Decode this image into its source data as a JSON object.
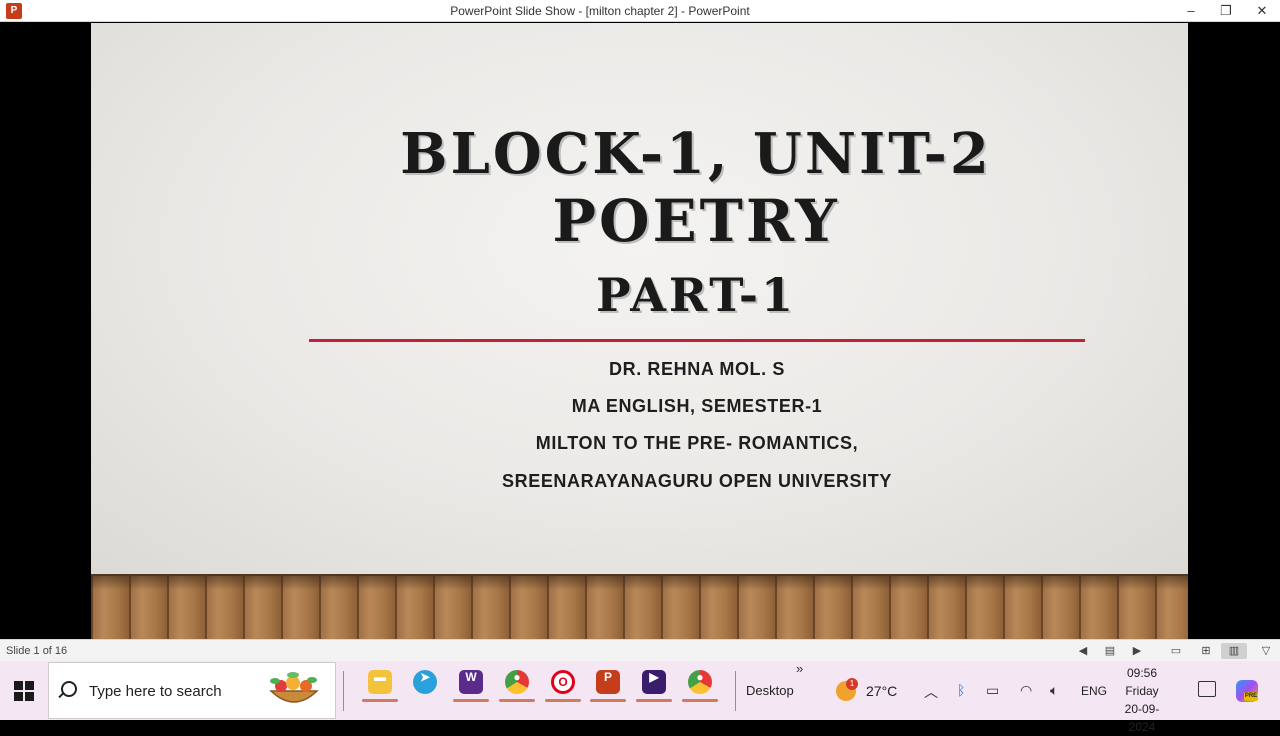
{
  "window": {
    "title": "PowerPoint Slide Show - [milton chapter 2] - PowerPoint",
    "app_icon": "powerpoint-icon",
    "controls": {
      "minimize": "–",
      "restore": "❐",
      "close": "✕"
    }
  },
  "slide": {
    "title_line1": "BLOCK-1, UNIT-2",
    "title_line2": "POETRY",
    "title_line3": "PART-1",
    "subtitle_lines": [
      "DR. REHNA MOL. S",
      "MA ENGLISH, SEMESTER-1",
      "MILTON  TO THE PRE- ROMANTICS,",
      "SREENARAYANAGURU OPEN UNIVERSITY"
    ],
    "accent_rule_color": "#c0203a"
  },
  "statusbar": {
    "slide_counter": "Slide 1 of 16",
    "icons": [
      "previous-icon",
      "menu-icon",
      "next-icon",
      "normal-view-icon",
      "slide-sorter-icon",
      "reading-view-icon",
      "slideshow-icon"
    ]
  },
  "taskbar": {
    "search_placeholder": "Type here to search",
    "pinned_apps": [
      "file-explorer",
      "telegram",
      "video-editor",
      "chrome",
      "opera",
      "powerpoint",
      "media-player",
      "chrome-profile"
    ],
    "desktop_label": "Desktop",
    "weather_badge": "1",
    "temperature": "27°C",
    "language": "ENG",
    "time": "09:56",
    "day": "Friday",
    "date": "20-09-2024",
    "copilot_badge": "PRE"
  }
}
